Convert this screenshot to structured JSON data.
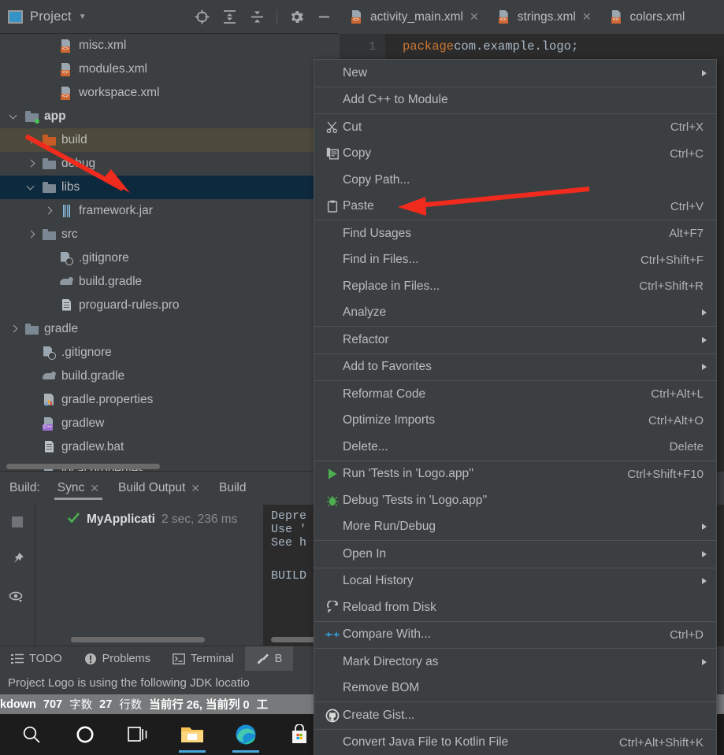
{
  "project_panel": {
    "title": "Project",
    "icons": [
      "project-view-icon",
      "chevron-down-icon",
      "locate-icon",
      "expand-all-icon",
      "collapse-all-icon",
      "settings-gear-icon",
      "hide-icon"
    ],
    "tree": [
      {
        "label": "misc.xml",
        "icon": "xml-file-icon",
        "indent": 3,
        "arrow": "none",
        "state": "normal"
      },
      {
        "label": "modules.xml",
        "icon": "xml-file-icon",
        "indent": 3,
        "arrow": "none",
        "state": "normal"
      },
      {
        "label": "workspace.xml",
        "icon": "xml-file-icon",
        "indent": 3,
        "arrow": "none",
        "state": "normal"
      },
      {
        "label": "app",
        "icon": "folder-module-icon",
        "indent": 1,
        "arrow": "down",
        "state": "bold"
      },
      {
        "label": "build",
        "icon": "folder-orange-icon",
        "indent": 2,
        "arrow": "right",
        "state": "highlight"
      },
      {
        "label": "debug",
        "icon": "folder-icon",
        "indent": 2,
        "arrow": "right",
        "state": "normal"
      },
      {
        "label": "libs",
        "icon": "folder-icon",
        "indent": 2,
        "arrow": "down",
        "state": "selected"
      },
      {
        "label": "framework.jar",
        "icon": "jar-file-icon",
        "indent": 3,
        "arrow": "right",
        "state": "normal"
      },
      {
        "label": "src",
        "icon": "folder-icon",
        "indent": 2,
        "arrow": "right",
        "state": "normal"
      },
      {
        "label": ".gitignore",
        "icon": "gitignore-icon",
        "indent": 3,
        "arrow": "none",
        "state": "normal"
      },
      {
        "label": "build.gradle",
        "icon": "gradle-icon",
        "indent": 3,
        "arrow": "none",
        "state": "normal"
      },
      {
        "label": "proguard-rules.pro",
        "icon": "text-file-icon",
        "indent": 3,
        "arrow": "none",
        "state": "normal"
      },
      {
        "label": "gradle",
        "icon": "folder-icon",
        "indent": 1,
        "arrow": "right",
        "state": "normal"
      },
      {
        "label": ".gitignore",
        "icon": "gitignore-icon",
        "indent": 2,
        "arrow": "none",
        "state": "normal"
      },
      {
        "label": "build.gradle",
        "icon": "gradle-icon",
        "indent": 2,
        "arrow": "none",
        "state": "normal"
      },
      {
        "label": "gradle.properties",
        "icon": "properties-icon",
        "indent": 2,
        "arrow": "none",
        "state": "normal"
      },
      {
        "label": "gradlew",
        "icon": "cpp-file-icon",
        "indent": 2,
        "arrow": "none",
        "state": "normal"
      },
      {
        "label": "gradlew.bat",
        "icon": "text-file-icon",
        "indent": 2,
        "arrow": "none",
        "state": "normal"
      },
      {
        "label": "local.properties",
        "icon": "xml-file-icon",
        "indent": 2,
        "arrow": "none",
        "state": "normal"
      }
    ]
  },
  "editor": {
    "tabs": [
      {
        "label": "activity_main.xml",
        "icon": "xml-file-icon",
        "closable": true
      },
      {
        "label": "strings.xml",
        "icon": "xml-file-icon",
        "closable": true
      },
      {
        "label": "colors.xml",
        "icon": "xml-file-icon",
        "closable": true
      }
    ],
    "line_number": "1",
    "code_keyword": "package",
    "code_rest": " com.example.logo;"
  },
  "context_menu": {
    "items": [
      {
        "label": "New",
        "accel": "",
        "icon": "",
        "submenu": true,
        "mnemonic": ""
      },
      {
        "sep": true
      },
      {
        "label": "Add C++ to Module",
        "accel": "",
        "icon": "",
        "submenu": false,
        "mnemonic": ""
      },
      {
        "sep": true
      },
      {
        "label": "Cut",
        "accel": "Ctrl+X",
        "icon": "scissors-icon",
        "submenu": false,
        "mnemonic": "t"
      },
      {
        "label": "Copy",
        "accel": "Ctrl+C",
        "icon": "copy-icon",
        "submenu": false,
        "mnemonic": "C"
      },
      {
        "label": "Copy Path...",
        "accel": "",
        "icon": "",
        "submenu": false,
        "mnemonic": ""
      },
      {
        "label": "Paste",
        "accel": "Ctrl+V",
        "icon": "clipboard-icon",
        "submenu": false,
        "mnemonic": "P"
      },
      {
        "sep": true
      },
      {
        "label": "Find Usages",
        "accel": "Alt+F7",
        "icon": "",
        "submenu": false,
        "mnemonic": "U"
      },
      {
        "label": "Find in Files...",
        "accel": "Ctrl+Shift+F",
        "icon": "",
        "submenu": false,
        "mnemonic": ""
      },
      {
        "label": "Replace in Files...",
        "accel": "Ctrl+Shift+R",
        "icon": "",
        "submenu": false,
        "mnemonic": "a"
      },
      {
        "label": "Analyze",
        "accel": "",
        "icon": "",
        "submenu": true,
        "mnemonic": "z"
      },
      {
        "sep": true
      },
      {
        "label": "Refactor",
        "accel": "",
        "icon": "",
        "submenu": true,
        "mnemonic": "R"
      },
      {
        "sep": true
      },
      {
        "label": "Add to Favorites",
        "accel": "",
        "icon": "",
        "submenu": true,
        "mnemonic": "F"
      },
      {
        "sep": true
      },
      {
        "label": "Reformat Code",
        "accel": "Ctrl+Alt+L",
        "icon": "",
        "submenu": false,
        "mnemonic": "R"
      },
      {
        "label": "Optimize Imports",
        "accel": "Ctrl+Alt+O",
        "icon": "",
        "submenu": false,
        "mnemonic": "z"
      },
      {
        "label": "Delete...",
        "accel": "Delete",
        "icon": "",
        "submenu": false,
        "mnemonic": "D"
      },
      {
        "sep": true
      },
      {
        "label": "Run 'Tests in 'Logo.app''",
        "accel": "Ctrl+Shift+F10",
        "icon": "run-play-icon",
        "submenu": false,
        "mnemonic": "u"
      },
      {
        "label": "Debug 'Tests in 'Logo.app''",
        "accel": "",
        "icon": "debug-bug-icon",
        "submenu": false,
        "mnemonic": "D"
      },
      {
        "label": "More Run/Debug",
        "accel": "",
        "icon": "",
        "submenu": true,
        "mnemonic": ""
      },
      {
        "sep": true
      },
      {
        "label": "Open In",
        "accel": "",
        "icon": "",
        "submenu": true,
        "mnemonic": ""
      },
      {
        "sep": true
      },
      {
        "label": "Local History",
        "accel": "",
        "icon": "",
        "submenu": true,
        "mnemonic": "H"
      },
      {
        "label": "Reload from Disk",
        "accel": "",
        "icon": "reload-icon",
        "submenu": false,
        "mnemonic": ""
      },
      {
        "sep": true
      },
      {
        "label": "Compare With...",
        "accel": "Ctrl+D",
        "icon": "compare-icon",
        "submenu": false,
        "mnemonic": ""
      },
      {
        "sep": true
      },
      {
        "label": "Mark Directory as",
        "accel": "",
        "icon": "",
        "submenu": true,
        "mnemonic": ""
      },
      {
        "label": "Remove BOM",
        "accel": "",
        "icon": "",
        "submenu": false,
        "mnemonic": ""
      },
      {
        "sep": true
      },
      {
        "label": "Create Gist...",
        "accel": "",
        "icon": "github-icon",
        "submenu": false,
        "mnemonic": ""
      },
      {
        "sep": true
      },
      {
        "label": "Convert Java File to Kotlin File",
        "accel": "Ctrl+Alt+Shift+K",
        "icon": "",
        "submenu": false,
        "mnemonic": ""
      }
    ]
  },
  "build_window": {
    "label": "Build:",
    "tabs": [
      {
        "label": "Sync",
        "closable": true,
        "active": true
      },
      {
        "label": "Build Output",
        "closable": true,
        "active": false
      },
      {
        "label": "Build",
        "closable": false,
        "active": false
      }
    ],
    "side_icons": [
      "stop-icon",
      "pin-icon",
      "eye-icon"
    ],
    "sync_node": {
      "status_icon": "green-check-icon",
      "name": "MyApplicati",
      "duration": "2 sec, 236 ms"
    },
    "output_lines": [
      "Depre",
      "Use '",
      "See h",
      "",
      "BUILD"
    ]
  },
  "bottom_toolbar": {
    "items": [
      {
        "label": "TODO",
        "icon": "todo-list-icon",
        "active": false
      },
      {
        "label": "Problems",
        "icon": "problems-icon",
        "active": false
      },
      {
        "label": "Terminal",
        "icon": "terminal-icon",
        "active": false
      },
      {
        "label": "B",
        "icon": "build-hammer-icon",
        "active": true
      }
    ]
  },
  "status_bar": {
    "message": "Project Logo is using the following JDK locatio"
  },
  "markdown_bar": {
    "segments": [
      "kdown",
      "707",
      "字数",
      "27",
      "行数",
      "当前行 26, 当前列 0",
      "工"
    ]
  },
  "taskbar": {
    "items": [
      {
        "name": "search-icon",
        "running": false
      },
      {
        "name": "cortana-circle-icon",
        "running": false
      },
      {
        "name": "task-view-icon",
        "running": false
      },
      {
        "name": "file-explorer-icon",
        "running": true
      },
      {
        "name": "edge-browser-icon",
        "running": true
      },
      {
        "name": "microsoft-store-icon",
        "running": false
      },
      {
        "name": "mail-icon",
        "running": false
      }
    ]
  },
  "annotations": {
    "arrow_color": "#f02b1d",
    "arrows": [
      {
        "name": "arrow-to-libs",
        "target": "libs"
      },
      {
        "name": "arrow-to-paste",
        "target": "Paste"
      }
    ]
  },
  "colors": {
    "panel_bg": "#3c3f41",
    "editor_bg": "#2b2b2b",
    "selection": "#0d293e",
    "highlight": "#4e4a3b",
    "text": "#bbbbbb",
    "accent_orange": "#cc7832",
    "accent_blue": "#3592c4",
    "green": "#49c357"
  }
}
